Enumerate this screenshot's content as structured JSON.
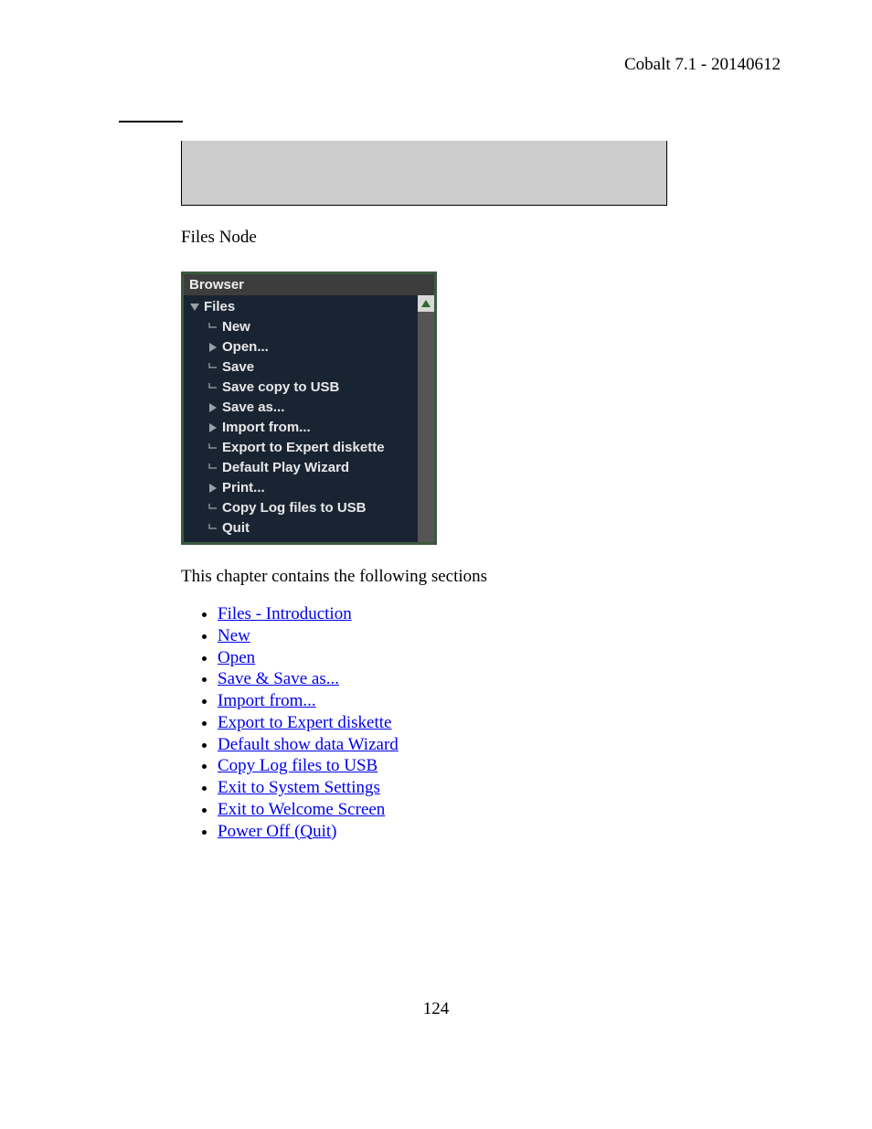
{
  "header": {
    "right": "Cobalt 7.1 - 20140612"
  },
  "caption": "Files Node",
  "browser": {
    "title": "Browser",
    "root": "Files",
    "items": [
      {
        "label": "New",
        "expander": "none"
      },
      {
        "label": "Open...",
        "expander": "right"
      },
      {
        "label": "Save",
        "expander": "none"
      },
      {
        "label": "Save copy to USB",
        "expander": "none"
      },
      {
        "label": "Save as...",
        "expander": "right"
      },
      {
        "label": "Import from...",
        "expander": "right"
      },
      {
        "label": "Export to Expert diskette",
        "expander": "none"
      },
      {
        "label": "Default Play Wizard",
        "expander": "none"
      },
      {
        "label": "Print...",
        "expander": "right"
      },
      {
        "label": "Copy Log files to USB",
        "expander": "none"
      },
      {
        "label": "Quit",
        "expander": "none"
      }
    ]
  },
  "intro": "This chapter contains the following sections",
  "links": [
    "Files - Introduction",
    "New",
    "Open",
    "Save & Save as...",
    "Import from...",
    "Export to Expert diskette",
    "Default show data Wizard",
    "Copy Log files to USB",
    "Exit to System Settings",
    "Exit to Welcome Screen",
    "Power Off (Quit)"
  ],
  "pageNumber": "124"
}
